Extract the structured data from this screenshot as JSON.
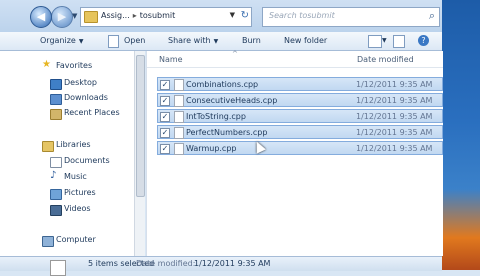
{
  "address": {
    "back_glyph": "◀",
    "forward_glyph": "▶",
    "crumbs": [
      "Assig...",
      "tosubmit"
    ],
    "search_placeholder": "Search tosubmit"
  },
  "toolbar": {
    "organize": "Organize",
    "open": "Open",
    "share_with": "Share with",
    "burn": "Burn",
    "new_folder": "New folder",
    "help": "?"
  },
  "nav": {
    "favorites": "Favorites",
    "desktop": "Desktop",
    "downloads": "Downloads",
    "recent_places": "Recent Places",
    "libraries": "Libraries",
    "documents": "Documents",
    "music": "Music",
    "pictures": "Pictures",
    "videos": "Videos",
    "computer": "Computer"
  },
  "list": {
    "columns": [
      "Name",
      "Date modified"
    ],
    "files": [
      {
        "name": "Combinations.cpp",
        "date": "1/12/2011 9:35 AM"
      },
      {
        "name": "ConsecutiveHeads.cpp",
        "date": "1/12/2011 9:35 AM"
      },
      {
        "name": "IntToString.cpp",
        "date": "1/12/2011 9:35 AM"
      },
      {
        "name": "PerfectNumbers.cpp",
        "date": "1/12/2011 9:35 AM"
      },
      {
        "name": "Warmup.cpp",
        "date": "1/12/2011 9:35 AM"
      }
    ]
  },
  "status": {
    "count": "5 items selected",
    "date_label": "Date modified:",
    "date_value": "1/12/2011 9:35 AM"
  },
  "colors": {
    "selection": "#c1d8f1",
    "selection_border": "#84acdd",
    "accent": "#3a78c4"
  }
}
